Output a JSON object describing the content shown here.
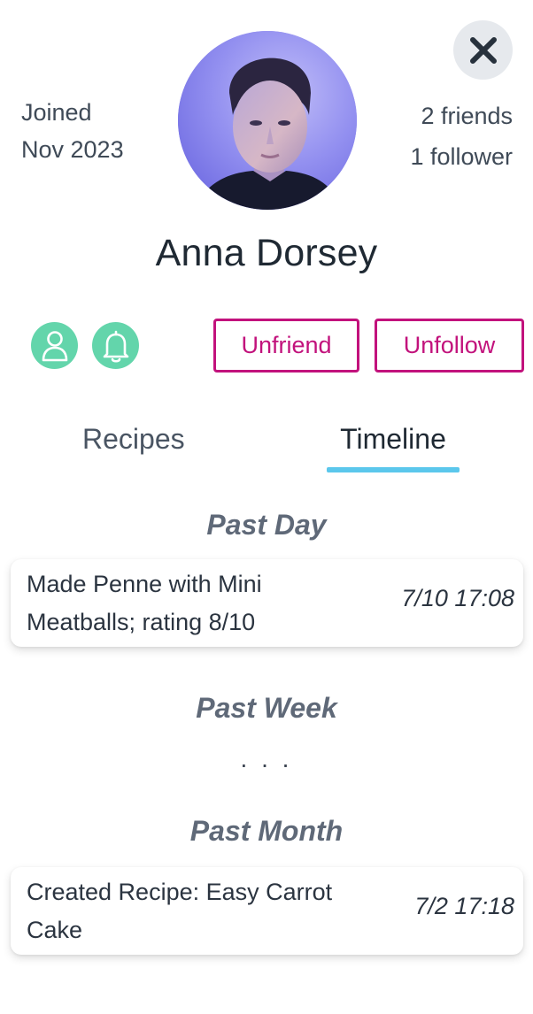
{
  "profile": {
    "joined_label": "Joined",
    "joined_date": "Nov 2023",
    "friends": "2 friends",
    "followers": "1 follower",
    "name": "Anna Dorsey"
  },
  "actions": {
    "unfriend_label": "Unfriend",
    "unfollow_label": "Unfollow"
  },
  "tabs": [
    {
      "label": "Recipes",
      "active": false
    },
    {
      "label": "Timeline",
      "active": true
    }
  ],
  "timeline": {
    "sections": [
      {
        "heading": "Past Day",
        "entries": [
          {
            "text": "Made Penne with Mini Meatballs; rating 8/10",
            "time": "7/10 17:08"
          }
        ]
      },
      {
        "heading": "Past Week",
        "placeholder": ". . ."
      },
      {
        "heading": "Past Month",
        "entries": [
          {
            "text": "Created Recipe: Easy Carrot Cake",
            "time": "7/2 17:18"
          }
        ]
      }
    ]
  },
  "colors": {
    "accent_magenta": "#c2127c",
    "icon_green": "#63d5ab",
    "tab_underline": "#5bc7ec",
    "avatar_bg": "#8e8bef"
  },
  "icons": {
    "close": "close-icon",
    "friend": "user-icon",
    "notifications": "bell-icon"
  }
}
